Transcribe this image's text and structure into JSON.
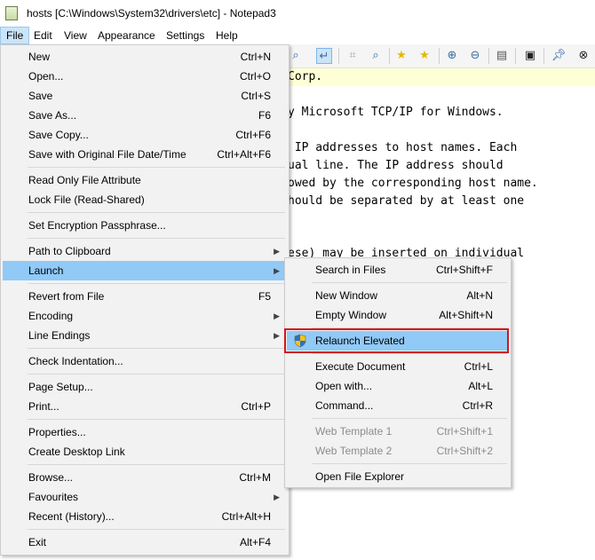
{
  "window": {
    "title": "hosts [C:\\Windows\\System32\\drivers\\etc] - Notepad3"
  },
  "menubar": {
    "items": [
      "File",
      "Edit",
      "View",
      "Appearance",
      "Settings",
      "Help"
    ]
  },
  "editor": {
    "lines": [
      "Corp.",
      "",
      "y Microsoft TCP/IP for Windows.",
      "",
      " IP addresses to host names. Each",
      "ual line. The IP address should",
      "owed by the corresponding host name.",
      "hould be separated by at least one",
      "",
      "",
      "ese) may be inserted on individual"
    ]
  },
  "file_menu": {
    "items": [
      {
        "label": "New",
        "accel": "Ctrl+N"
      },
      {
        "label": "Open...",
        "accel": "Ctrl+O"
      },
      {
        "label": "Save",
        "accel": "Ctrl+S"
      },
      {
        "label": "Save As...",
        "accel": "F6"
      },
      {
        "label": "Save Copy...",
        "accel": "Ctrl+F6"
      },
      {
        "label": "Save with Original File Date/Time",
        "accel": "Ctrl+Alt+F6"
      },
      {
        "label": "Read Only File Attribute",
        "accel": ""
      },
      {
        "label": "Lock File (Read-Shared)",
        "accel": ""
      },
      {
        "label": "Set Encryption Passphrase...",
        "accel": ""
      },
      {
        "label": "Path to Clipboard",
        "accel": ""
      },
      {
        "label": "Launch",
        "accel": ""
      },
      {
        "label": "Revert from File",
        "accel": "F5"
      },
      {
        "label": "Encoding",
        "accel": ""
      },
      {
        "label": "Line Endings",
        "accel": ""
      },
      {
        "label": "Check Indentation...",
        "accel": ""
      },
      {
        "label": "Page Setup...",
        "accel": ""
      },
      {
        "label": "Print...",
        "accel": "Ctrl+P"
      },
      {
        "label": "Properties...",
        "accel": ""
      },
      {
        "label": "Create Desktop Link",
        "accel": ""
      },
      {
        "label": "Browse...",
        "accel": "Ctrl+M"
      },
      {
        "label": "Favourites",
        "accel": ""
      },
      {
        "label": "Recent (History)...",
        "accel": "Ctrl+Alt+H"
      },
      {
        "label": "Exit",
        "accel": "Alt+F4"
      }
    ]
  },
  "launch_menu": {
    "items": [
      {
        "label": "Search in Files",
        "accel": "Ctrl+Shift+F"
      },
      {
        "label": "New Window",
        "accel": "Alt+N"
      },
      {
        "label": "Empty Window",
        "accel": "Alt+Shift+N"
      },
      {
        "label": "Relaunch Elevated",
        "accel": ""
      },
      {
        "label": "Execute Document",
        "accel": "Ctrl+L"
      },
      {
        "label": "Open with...",
        "accel": "Alt+L"
      },
      {
        "label": "Command...",
        "accel": "Ctrl+R"
      },
      {
        "label": "Web Template 1",
        "accel": "Ctrl+Shift+1"
      },
      {
        "label": "Web Template 2",
        "accel": "Ctrl+Shift+2"
      },
      {
        "label": "Open File Explorer",
        "accel": ""
      }
    ]
  },
  "colors": {
    "menu_bg": "#f2f2f2",
    "selection": "#91c9f7",
    "highlight_box": "#d2161e",
    "current_line": "#ffffd5"
  }
}
